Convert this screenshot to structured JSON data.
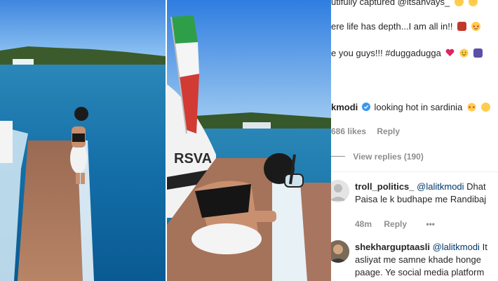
{
  "comments_panel": {
    "caption_lines": [
      "utifully captured @itsanvays_",
      "ere life has depth...I am all in!!",
      "e you guys!!! #duggadugga"
    ],
    "comment1": {
      "username": "kmodi",
      "text": "looking hot in sardinia",
      "likes": "686 likes",
      "reply_label": "Reply",
      "view_replies": "View replies (190)"
    },
    "comment2": {
      "username": "troll_politics_",
      "mention": "@lalitkmodi",
      "text_line1": "Dhat",
      "text_line2": "Paisa le k budhape me Randibaj",
      "time": "48m",
      "reply_label": "Reply",
      "more": "•••"
    },
    "comment3": {
      "username": "shekharguptaasli",
      "mention": "@lalitkmodi",
      "text_line1": "It",
      "text_line2": "asliyat me samne khade honge",
      "text_line3": "paage. Ye social media platform"
    }
  },
  "photo_right": {
    "boat_text": "RSVA"
  },
  "colors": {
    "sky": "#4b93e6",
    "sea": "#1d7ab8",
    "deck": "#a07158",
    "link": "#00376b",
    "muted": "#8e8e8e",
    "heart": "#e0245e"
  }
}
